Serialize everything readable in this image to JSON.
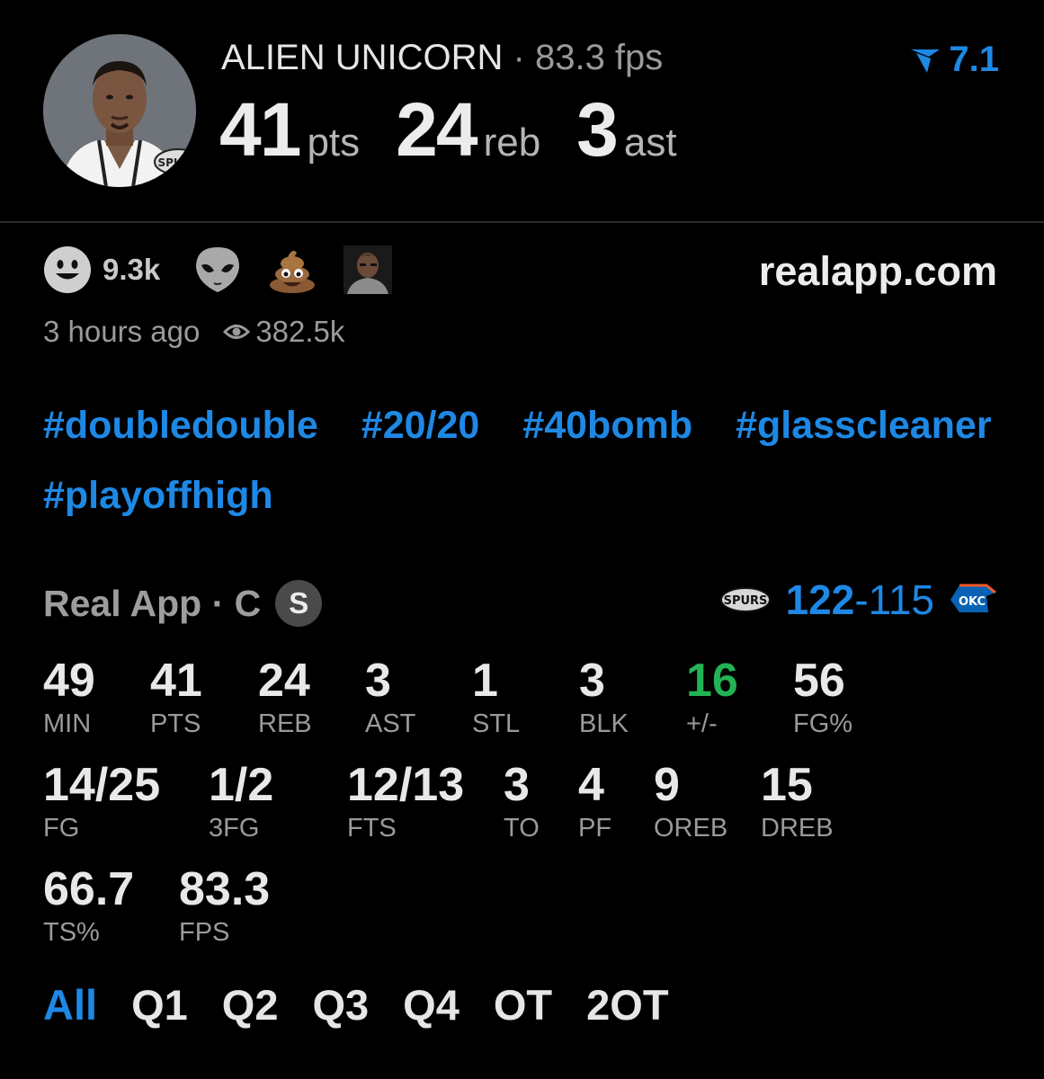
{
  "header": {
    "player_name": "ALIEN UNICORN",
    "separator": "·",
    "fps_text": "83.3 fps",
    "rating": "7.1",
    "big_stats": [
      {
        "value": "41",
        "unit": "pts"
      },
      {
        "value": "24",
        "unit": "reb"
      },
      {
        "value": "3",
        "unit": "ast"
      }
    ]
  },
  "reactions": {
    "count": "9.3k",
    "icons": [
      "smile-emoji-icon",
      "alien-emoji-icon",
      "poop-emoji-icon",
      "user-avatar-icon"
    ]
  },
  "site": "realapp.com",
  "meta": {
    "time_ago": "3 hours ago",
    "views": "382.5k"
  },
  "hashtags": [
    "#doubledouble",
    "#20/20",
    "#40bomb",
    "#glasscleaner",
    "#playoffhigh"
  ],
  "card": {
    "source": "Real App · C",
    "badge": "S",
    "score_home": "122",
    "score_sep": "-",
    "score_away": "115"
  },
  "stats": {
    "row1": [
      {
        "value": "49",
        "label": "MIN"
      },
      {
        "value": "41",
        "label": "PTS"
      },
      {
        "value": "24",
        "label": "REB"
      },
      {
        "value": "3",
        "label": "AST"
      },
      {
        "value": "1",
        "label": "STL"
      },
      {
        "value": "3",
        "label": "BLK"
      },
      {
        "value": "16",
        "label": "+/-"
      },
      {
        "value": "56",
        "label": "FG%"
      }
    ],
    "row2": [
      {
        "value": "14/25",
        "label": "FG"
      },
      {
        "value": "1/2",
        "label": "3FG"
      },
      {
        "value": "12/13",
        "label": "FTS"
      },
      {
        "value": "3",
        "label": "TO"
      },
      {
        "value": "4",
        "label": "PF"
      },
      {
        "value": "9",
        "label": "OREB"
      },
      {
        "value": "15",
        "label": "DREB"
      }
    ],
    "row3": [
      {
        "value": "66.7",
        "label": "TS%"
      },
      {
        "value": "83.3",
        "label": "FPS"
      }
    ]
  },
  "tabs": [
    "All",
    "Q1",
    "Q2",
    "Q3",
    "Q4",
    "OT",
    "2OT"
  ],
  "active_tab": "All",
  "colors": {
    "accent": "#1e88e5",
    "positive": "#22b355",
    "background": "#000000"
  }
}
